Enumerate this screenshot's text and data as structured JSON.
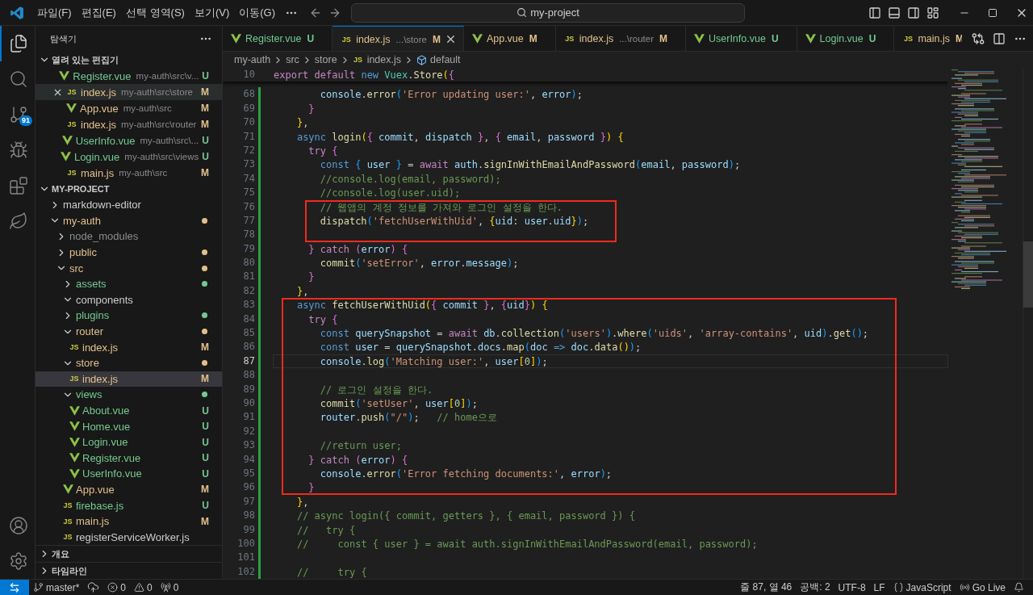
{
  "title_bar": {
    "menus": [
      "파일(F)",
      "편집(E)",
      "선택 영역(S)",
      "보기(V)",
      "이동(G)"
    ],
    "command_center": "my-project"
  },
  "activity_bar": {
    "top": [
      {
        "kind": "explorer",
        "selected": true
      },
      {
        "kind": "search",
        "selected": false
      },
      {
        "kind": "scm",
        "selected": false,
        "badge": "91"
      },
      {
        "kind": "debug",
        "selected": false
      },
      {
        "kind": "extensions",
        "selected": false
      },
      {
        "kind": "mongodb",
        "selected": false
      }
    ],
    "bottom": [
      {
        "kind": "accounts"
      },
      {
        "kind": "settings"
      }
    ]
  },
  "sidebar": {
    "title": "탐색기",
    "open_editors": {
      "title": "열려 있는 편집기",
      "expanded": true,
      "items": [
        {
          "name": "Register.vue",
          "path": "my-auth\\src\\v...",
          "status": "U",
          "color": "#73c991",
          "selected": false
        },
        {
          "name": "index.js",
          "icon_text": "JS",
          "path": "my-auth\\src\\store",
          "status": "M",
          "color": "#e2c08d",
          "selected": true
        },
        {
          "name": "App.vue",
          "path": "my-auth\\src",
          "status": "M",
          "color": "#e2c08d",
          "selected": false
        },
        {
          "name": "index.js",
          "icon_text": "JS",
          "path": "my-auth\\src\\router",
          "status": "M",
          "color": "#e2c08d",
          "selected": false
        },
        {
          "name": "UserInfo.vue",
          "path": "my-auth\\src\\...",
          "status": "U",
          "color": "#73c991",
          "selected": false
        },
        {
          "name": "Login.vue",
          "path": "my-auth\\src\\views",
          "status": "U",
          "color": "#73c991",
          "selected": false
        },
        {
          "name": "main.js",
          "icon_text": "JS",
          "path": "my-auth\\src",
          "status": "M",
          "color": "#e2c08d",
          "selected": false
        }
      ]
    },
    "project": {
      "title": "MY-PROJECT",
      "expanded": true,
      "tree": [
        {
          "kind": "folder",
          "name": "markdown-editor",
          "expanded": false,
          "has_changes": false,
          "color": "#cccccc",
          "selected": false
        },
        {
          "kind": "folder",
          "name": "my-auth",
          "expanded": true,
          "has_changes": true,
          "color": "#e2c08d",
          "selected": false,
          "children": [
            {
              "kind": "folder",
              "name": "node_modules",
              "expanded": false,
              "has_changes": false,
              "color": "#8c8c8c",
              "selected": false
            },
            {
              "kind": "folder",
              "name": "public",
              "expanded": false,
              "has_changes": true,
              "color": "#e2c08d",
              "selected": false
            },
            {
              "kind": "folder",
              "name": "src",
              "expanded": true,
              "has_changes": true,
              "color": "#e2c08d",
              "selected": false,
              "children": [
                {
                  "kind": "folder",
                  "name": "assets",
                  "expanded": false,
                  "has_changes": true,
                  "color": "#73c991",
                  "selected": false
                },
                {
                  "kind": "folder",
                  "name": "components",
                  "expanded": true,
                  "has_changes": false,
                  "color": "#cccccc",
                  "selected": false
                },
                {
                  "kind": "folder",
                  "name": "plugins",
                  "expanded": false,
                  "has_changes": true,
                  "color": "#73c991",
                  "selected": false
                },
                {
                  "kind": "folder",
                  "name": "router",
                  "expanded": true,
                  "has_changes": true,
                  "color": "#e2c08d",
                  "selected": false,
                  "children": [
                    {
                      "kind": "file",
                      "name": "index.js",
                      "icon_text": "JS",
                      "status": "M",
                      "color": "#e2c08d",
                      "selected": false
                    }
                  ]
                },
                {
                  "kind": "folder",
                  "name": "store",
                  "expanded": true,
                  "has_changes": true,
                  "color": "#e2c08d",
                  "selected": false,
                  "children": [
                    {
                      "kind": "file",
                      "name": "index.js",
                      "icon_text": "JS",
                      "status": "M",
                      "color": "#e2c08d",
                      "selected": true
                    }
                  ]
                },
                {
                  "kind": "folder",
                  "name": "views",
                  "expanded": true,
                  "has_changes": true,
                  "color": "#73c991",
                  "selected": false,
                  "children": [
                    {
                      "kind": "file",
                      "name": "About.vue",
                      "status": "U",
                      "color": "#73c991",
                      "selected": false
                    },
                    {
                      "kind": "file",
                      "name": "Home.vue",
                      "status": "U",
                      "color": "#73c991",
                      "selected": false
                    },
                    {
                      "kind": "file",
                      "name": "Login.vue",
                      "status": "U",
                      "color": "#73c991",
                      "selected": false
                    },
                    {
                      "kind": "file",
                      "name": "Register.vue",
                      "status": "U",
                      "color": "#73c991",
                      "selected": false
                    },
                    {
                      "kind": "file",
                      "name": "UserInfo.vue",
                      "status": "U",
                      "color": "#73c991",
                      "selected": false
                    }
                  ]
                },
                {
                  "kind": "file",
                  "name": "App.vue",
                  "status": "M",
                  "color": "#e2c08d",
                  "selected": false
                },
                {
                  "kind": "file",
                  "name": "firebase.js",
                  "icon_text": "JS",
                  "status": "U",
                  "color": "#73c991",
                  "selected": false
                },
                {
                  "kind": "file",
                  "name": "main.js",
                  "icon_text": "JS",
                  "status": "M",
                  "color": "#e2c08d",
                  "selected": false
                },
                {
                  "kind": "file",
                  "name": "registerServiceWorker.js",
                  "icon_text": "JS",
                  "color": "#cccccc",
                  "selected": false
                }
              ]
            }
          ]
        }
      ]
    },
    "sections": [
      {
        "title": "개요",
        "expanded": false
      },
      {
        "title": "타임라인",
        "expanded": false
      }
    ]
  },
  "tabs": [
    {
      "name": "Register.vue",
      "status": "U",
      "color": "#73c991",
      "selected": false
    },
    {
      "name": "index.js",
      "icon_text": "JS",
      "detail": "...\\store",
      "status": "M",
      "color": "#e2c08d",
      "selected": true
    },
    {
      "name": "App.vue",
      "status": "M",
      "color": "#e2c08d",
      "selected": false
    },
    {
      "name": "index.js",
      "icon_text": "JS",
      "detail": "...\\router",
      "status": "M",
      "color": "#e2c08d",
      "selected": false
    },
    {
      "name": "UserInfo.vue",
      "status": "U",
      "color": "#73c991",
      "selected": false
    },
    {
      "name": "Login.vue",
      "status": "U",
      "color": "#73c991",
      "selected": false
    },
    {
      "name": "main.js",
      "icon_text": "JS",
      "status": "M",
      "color": "#e2c08d",
      "selected": false
    }
  ],
  "editor": {
    "breadcrumb": [
      {
        "kind": "folder",
        "text": "my-auth"
      },
      {
        "kind": "folder",
        "text": "src"
      },
      {
        "kind": "folder",
        "text": "store"
      },
      {
        "kind": "file",
        "text": "index.js",
        "icon_text": "JS"
      },
      {
        "kind": "symbol",
        "text": "default"
      }
    ],
    "sticky_line": {
      "number": "10",
      "text": "export default new Vuex.Store({"
    },
    "blocks": [
      {
        "changed": true,
        "highlighted": false,
        "lines": [
          {
            "number": "68",
            "current": false,
            "text": "        console.error('Error updating user:', error);"
          },
          {
            "number": "69",
            "current": false,
            "text": "      }"
          },
          {
            "number": "70",
            "current": false,
            "text": "    },"
          },
          {
            "number": "71",
            "current": false,
            "text": "    async login({ commit, dispatch }, { email, password }) {"
          },
          {
            "number": "72",
            "current": false,
            "text": "      try {"
          },
          {
            "number": "73",
            "current": false,
            "text": "        const { user } = await auth.signInWithEmailAndPassword(email, password);"
          },
          {
            "number": "74",
            "current": false,
            "text": "        //console.log(email, password);"
          },
          {
            "number": "75",
            "current": false,
            "text": "        //console.log(user.uid);"
          }
        ]
      },
      {
        "changed": true,
        "highlighted": true,
        "lines": [
          {
            "number": "76",
            "current": false,
            "text": "        // 웹앱의 계정 정보를 가져와 로그인 설정을 한다."
          },
          {
            "number": "77",
            "current": false,
            "text": "        dispatch('fetchUserWithUid', {uid: user.uid});"
          },
          {
            "number": "78",
            "current": false
          }
        ]
      },
      {
        "changed": true,
        "highlighted": false,
        "lines": [
          {
            "number": "79",
            "current": false,
            "text": "      } catch (error) {"
          },
          {
            "number": "80",
            "current": false,
            "text": "        commit('setError', error.message);"
          },
          {
            "number": "81",
            "current": false,
            "text": "      }"
          },
          {
            "number": "82",
            "current": false,
            "text": "    },"
          }
        ]
      },
      {
        "changed": true,
        "highlighted": true,
        "lines": [
          {
            "number": "83",
            "current": false,
            "text": "    async fetchUserWithUid({ commit }, {uid}) {"
          },
          {
            "number": "84",
            "current": false,
            "text": "      try {"
          },
          {
            "number": "85",
            "current": false,
            "text": "        const querySnapshot = await db.collection('users').where('uids', 'array-contains', uid).get();"
          },
          {
            "number": "86",
            "current": false,
            "text": "        const user = querySnapshot.docs.map(doc => doc.data());"
          },
          {
            "number": "87",
            "current": true,
            "text": "        console.log('Matching user:', user[0]);"
          },
          {
            "number": "88",
            "current": false
          },
          {
            "number": "89",
            "current": false,
            "text": "        // 로그인 설정을 한다."
          },
          {
            "number": "90",
            "current": false,
            "text": "        commit('setUser', user[0]);"
          },
          {
            "number": "91",
            "current": false,
            "text": "        router.push(\"/\");   // home으로"
          },
          {
            "number": "92",
            "current": false
          },
          {
            "number": "93",
            "current": false,
            "text": "        //return user;"
          },
          {
            "number": "94",
            "current": false,
            "text": "      } catch (error) {"
          },
          {
            "number": "95",
            "current": false,
            "text": "        console.error('Error fetching documents:', error);"
          },
          {
            "number": "96",
            "current": false,
            "text": "      }"
          }
        ]
      },
      {
        "changed": true,
        "highlighted": false,
        "lines": [
          {
            "number": "97",
            "current": false,
            "text": "    },"
          },
          {
            "number": "98",
            "current": false,
            "text": "    // async login({ commit, getters }, { email, password }) {"
          },
          {
            "number": "99",
            "current": false,
            "text": "    //   try {"
          },
          {
            "number": "100",
            "current": false,
            "text": "    //     const { user } = await auth.signInWithEmailAndPassword(email, password);"
          },
          {
            "number": "101",
            "current": false
          },
          {
            "number": "102",
            "current": false,
            "text": "    //     try {"
          }
        ]
      }
    ]
  },
  "status_bar": {
    "left": [
      {
        "kind": "branch",
        "text": "master*"
      },
      {
        "kind": "sync"
      },
      {
        "kind": "errors",
        "text": "0"
      },
      {
        "kind": "warnings",
        "text": "0"
      },
      {
        "kind": "ports",
        "text": "0"
      }
    ],
    "right": [
      {
        "kind": "position",
        "text": "줄 87, 열 46"
      },
      {
        "kind": "indent",
        "text": "공백: 2"
      },
      {
        "kind": "encoding",
        "text": "UTF-8"
      },
      {
        "kind": "eol",
        "text": "LF"
      },
      {
        "kind": "language",
        "text": "JavaScript"
      },
      {
        "kind": "golive",
        "text": "Go Live"
      },
      {
        "kind": "notifications"
      }
    ]
  }
}
